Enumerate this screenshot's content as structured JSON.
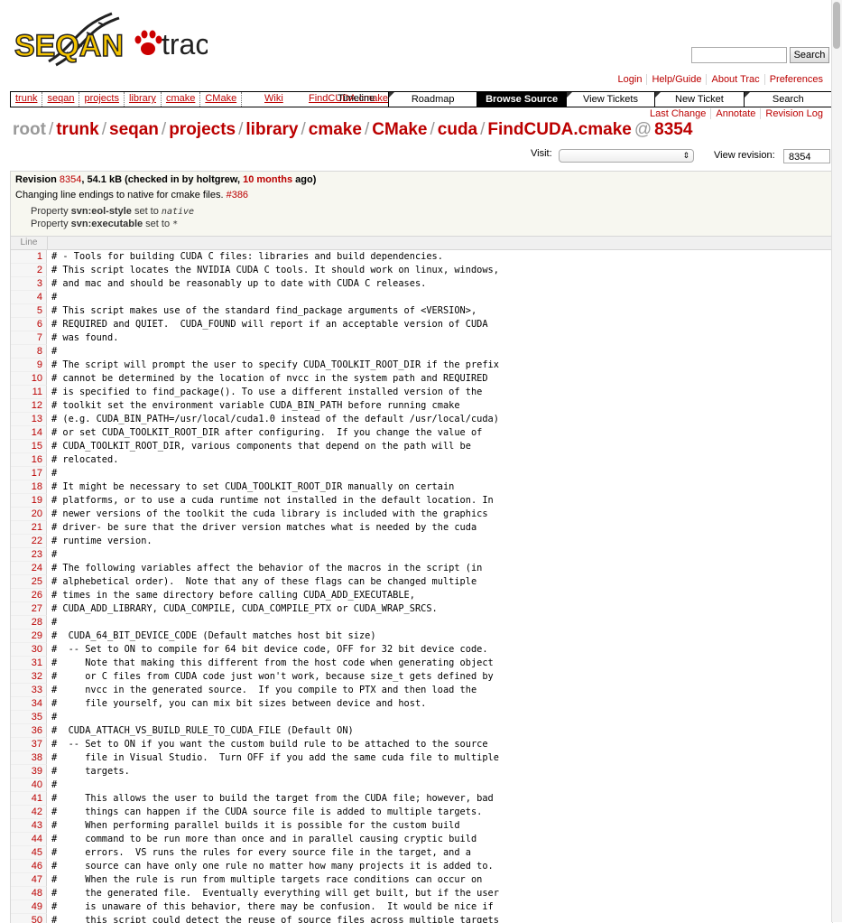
{
  "logo": {
    "text": "SEQAN",
    "suffix": "trac"
  },
  "search": {
    "placeholder": "",
    "button": "Search"
  },
  "metanav": [
    "Login",
    "Help/Guide",
    "About Trac",
    "Preferences"
  ],
  "mainnav": {
    "path_links": [
      "trunk",
      "seqan",
      "projects",
      "library",
      "cmake",
      "CMake"
    ],
    "overlap_a": "Wiki",
    "overlap_b": "FindCUDA.cmake",
    "overlap_c": "Timeline",
    "tabs": [
      {
        "label": "Roadmap",
        "active": false
      },
      {
        "label": "Browse Source",
        "active": true
      },
      {
        "label": "View Tickets",
        "active": false
      },
      {
        "label": "New Ticket",
        "active": false
      },
      {
        "label": "Search",
        "active": false
      }
    ]
  },
  "ctxtnav": [
    "Last Change",
    "Annotate",
    "Revision Log"
  ],
  "path": {
    "root": "root",
    "parts": [
      "trunk",
      "seqan",
      "projects",
      "library",
      "cmake",
      "CMake",
      "cuda",
      "FindCUDA.cmake"
    ],
    "at": "@",
    "revision": "8354"
  },
  "visit_label": "Visit:",
  "visit_value": "",
  "view_revision_label": "View revision:",
  "view_revision_value": "8354",
  "info": {
    "revision_word": "Revision",
    "revision": "8354",
    "size": ", 54.1 kB (checked in by holtgrew, ",
    "age": "10 months",
    "age_suffix": " ago)",
    "message": "Changing line endings to native for cmake files. ",
    "ticket": "#386",
    "props": [
      {
        "prefix": "Property ",
        "name": "svn:eol-style",
        "mid": " set to ",
        "value": "native"
      },
      {
        "prefix": "Property ",
        "name": "svn:executable",
        "mid": " set to ",
        "value": "*"
      }
    ]
  },
  "code": {
    "header": "Line",
    "lines": [
      "# - Tools for building CUDA C files: libraries and build dependencies.",
      "# This script locates the NVIDIA CUDA C tools. It should work on linux, windows,",
      "# and mac and should be reasonably up to date with CUDA C releases.",
      "#",
      "# This script makes use of the standard find_package arguments of <VERSION>,",
      "# REQUIRED and QUIET.  CUDA_FOUND will report if an acceptable version of CUDA",
      "# was found.",
      "#",
      "# The script will prompt the user to specify CUDA_TOOLKIT_ROOT_DIR if the prefix",
      "# cannot be determined by the location of nvcc in the system path and REQUIRED",
      "# is specified to find_package(). To use a different installed version of the",
      "# toolkit set the environment variable CUDA_BIN_PATH before running cmake",
      "# (e.g. CUDA_BIN_PATH=/usr/local/cuda1.0 instead of the default /usr/local/cuda)",
      "# or set CUDA_TOOLKIT_ROOT_DIR after configuring.  If you change the value of",
      "# CUDA_TOOLKIT_ROOT_DIR, various components that depend on the path will be",
      "# relocated.",
      "#",
      "# It might be necessary to set CUDA_TOOLKIT_ROOT_DIR manually on certain",
      "# platforms, or to use a cuda runtime not installed in the default location. In",
      "# newer versions of the toolkit the cuda library is included with the graphics",
      "# driver- be sure that the driver version matches what is needed by the cuda",
      "# runtime version.",
      "#",
      "# The following variables affect the behavior of the macros in the script (in",
      "# alphebetical order).  Note that any of these flags can be changed multiple",
      "# times in the same directory before calling CUDA_ADD_EXECUTABLE,",
      "# CUDA_ADD_LIBRARY, CUDA_COMPILE, CUDA_COMPILE_PTX or CUDA_WRAP_SRCS.",
      "#",
      "#  CUDA_64_BIT_DEVICE_CODE (Default matches host bit size)",
      "#  -- Set to ON to compile for 64 bit device code, OFF for 32 bit device code.",
      "#     Note that making this different from the host code when generating object",
      "#     or C files from CUDA code just won't work, because size_t gets defined by",
      "#     nvcc in the generated source.  If you compile to PTX and then load the",
      "#     file yourself, you can mix bit sizes between device and host.",
      "#",
      "#  CUDA_ATTACH_VS_BUILD_RULE_TO_CUDA_FILE (Default ON)",
      "#  -- Set to ON if you want the custom build rule to be attached to the source",
      "#     file in Visual Studio.  Turn OFF if you add the same cuda file to multiple",
      "#     targets.",
      "#",
      "#     This allows the user to build the target from the CUDA file; however, bad",
      "#     things can happen if the CUDA source file is added to multiple targets.",
      "#     When performing parallel builds it is possible for the custom build",
      "#     command to be run more than once and in parallel causing cryptic build",
      "#     errors.  VS runs the rules for every source file in the target, and a",
      "#     source can have only one rule no matter how many projects it is added to.",
      "#     When the rule is run from multiple targets race conditions can occur on",
      "#     the generated file.  Eventually everything will get built, but if the user",
      "#     is unaware of this behavior, there may be confusion.  It would be nice if",
      "#     this script could detect the reuse of source files across multiple targets"
    ]
  },
  "colors": {
    "link": "#bb0000",
    "accent": "#ffcc00",
    "nav_active": "#000000"
  }
}
